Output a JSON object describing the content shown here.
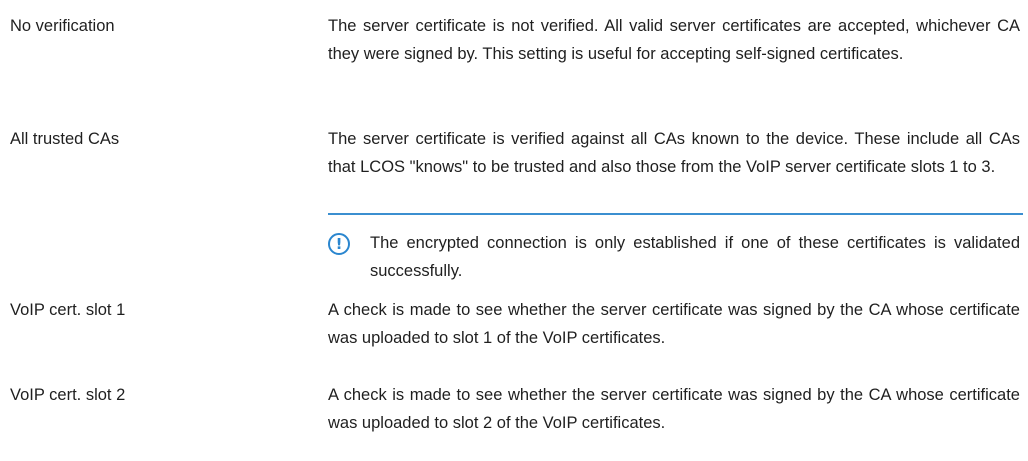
{
  "rows": [
    {
      "term": "No verification",
      "description": "The server certificate is not verified. All valid server certificates are accepted, whichever CA they were signed by. This setting is useful for accepting self-signed certificates."
    },
    {
      "term": "All trusted CAs",
      "description": "The server certificate is verified against all CAs known to the device. These include all CAs that LCOS \"knows\" to be trusted and also those from the VoIP server certificate slots 1 to 3.",
      "note": {
        "icon": "exclamation-circle-icon",
        "text": "The encrypted connection is only established if one of these certificates is validated successfully."
      }
    },
    {
      "term": "VoIP cert. slot 1",
      "description": "A check is made to see whether the server certificate was signed by the CA whose certificate was uploaded to slot 1 of the VoIP certificates."
    },
    {
      "term": "VoIP cert. slot 2",
      "description": "A check is made to see whether the server certificate was signed by the CA whose certificate was uploaded to slot 2 of the VoIP certificates."
    }
  ],
  "colors": {
    "text": "#1f1f1f",
    "accent": "#2a86cf"
  }
}
